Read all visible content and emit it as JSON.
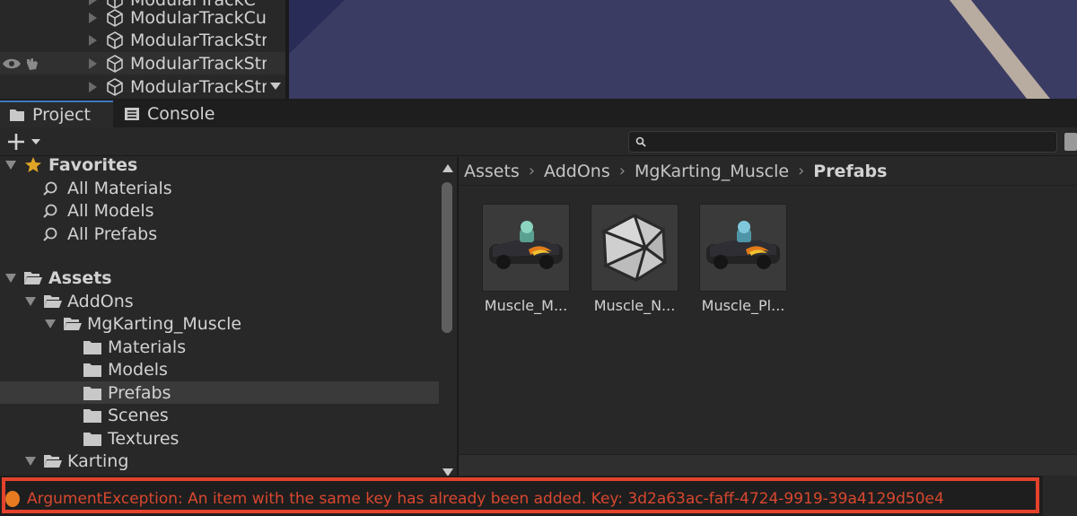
{
  "hierarchy": {
    "items": [
      {
        "label": "ModularTrackCu"
      },
      {
        "label": "ModularTrackStr"
      },
      {
        "label": "ModularTrackStr"
      },
      {
        "label": "ModularTrackStr"
      }
    ]
  },
  "tabs": {
    "project": "Project",
    "console": "Console"
  },
  "toolbar": {
    "search_value": ""
  },
  "tree": {
    "favorites": {
      "label": "Favorites",
      "items": [
        "All Materials",
        "All Models",
        "All Prefabs"
      ]
    },
    "assets_label": "Assets",
    "addons_label": "AddOns",
    "mgkarting_label": "MgKarting_Muscle",
    "subfolders": [
      "Materials",
      "Models",
      "Prefabs",
      "Scenes",
      "Textures"
    ],
    "karting_label": "Karting"
  },
  "breadcrumb": [
    "Assets",
    "AddOns",
    "MgKarting_Muscle",
    "Prefabs"
  ],
  "assets": [
    {
      "label": "Muscle_M...",
      "icon": "kart-prefab-icon"
    },
    {
      "label": "Muscle_N...",
      "icon": "mesh-icosahedron-icon"
    },
    {
      "label": "Muscle_Pl...",
      "icon": "kart-prefab-icon"
    }
  ],
  "status": {
    "error": "ArgumentException: An item with the same key has already been added. Key: 3d2a63ac-faff-4724-9919-39a4129d50e4"
  },
  "colors": {
    "scene_background": "#3b3c63",
    "error_text": "#d8472f",
    "error_highlight": "#e5422c",
    "tab_accent": "#3a79bb"
  }
}
